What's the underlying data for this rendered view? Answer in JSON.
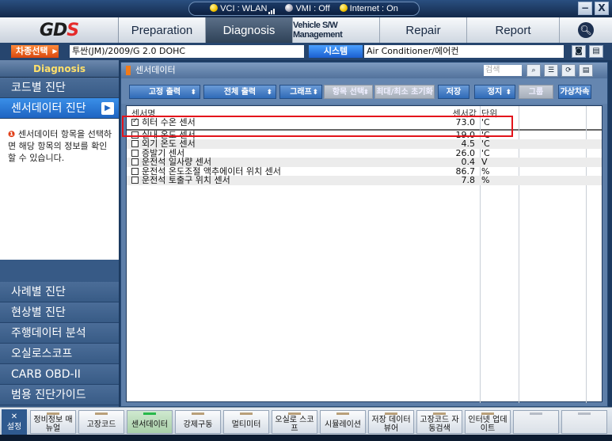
{
  "status": {
    "vci": "VCI : WLAN",
    "vmi": "VMI : Off",
    "internet": "Internet : On"
  },
  "window": {
    "min": "−",
    "close": "X"
  },
  "logo": {
    "text": "GDS"
  },
  "nav": {
    "tabs": [
      {
        "label": "Preparation"
      },
      {
        "label": "Diagnosis"
      },
      {
        "label": "Vehicle S/W Management"
      },
      {
        "label": "Repair"
      },
      {
        "label": "Report"
      }
    ]
  },
  "vehicle": {
    "select_label": "차종선택",
    "value": "투싼(JM)/2009/G 2.0 DOHC",
    "system_label": "시스템",
    "system_value": "Air Conditioner/에어컨"
  },
  "sidebar": {
    "header": "Diagnosis",
    "top_items": [
      "코드별 진단",
      "센서데이터 진단"
    ],
    "info": "센서데이터 항목을 선택하면 해당 항목의 정보를 확인 할 수 있습니다.",
    "bottom_items": [
      "사례별 진단",
      "현상별 진단",
      "주행데이터 분석",
      "오실로스코프",
      "CARB OBD-II",
      "범용 진단가이드"
    ]
  },
  "panel": {
    "title": "센서데이터",
    "search_placeholder": "검색",
    "toolbar": {
      "fixed_output": "고정 출력",
      "all_output": "전체 출력",
      "graph": "그래프",
      "item_select": "항목 선택",
      "minmax_reset": "최대/최소 초기화",
      "save": "저장",
      "stop": "정지",
      "group": "그룹",
      "virtual_vehicle": "가상차속"
    },
    "columns": {
      "name": "센서명",
      "value": "센서값",
      "unit": "단위"
    },
    "selected_rows": [
      {
        "name": "히터 수온 센서",
        "value": "73.0",
        "unit": "'C",
        "checked": true
      }
    ],
    "rows": [
      {
        "name": "실내 온도 센서",
        "value": "19.0",
        "unit": "'C"
      },
      {
        "name": "외기 온도 센서",
        "value": "4.5",
        "unit": "'C"
      },
      {
        "name": "증발기 센서",
        "value": "26.0",
        "unit": "'C"
      },
      {
        "name": "운전석 일사량 센서",
        "value": "0.4",
        "unit": "V"
      },
      {
        "name": "운전석 온도조절 액추에이터 위치 센서",
        "value": "86.7",
        "unit": "%"
      },
      {
        "name": "운전석 토출구 위치 센서",
        "value": "7.8",
        "unit": "%"
      }
    ]
  },
  "bottom": {
    "settings": "설정",
    "buttons": [
      "정비정보 매뉴얼",
      "고장코드",
      "센서데이터",
      "강제구동",
      "멀티미터",
      "오실로 스코프",
      "시뮬레이션",
      "저장 데이터 뷰어",
      "고장코드 자동검색",
      "인터넷 업데이트"
    ]
  }
}
